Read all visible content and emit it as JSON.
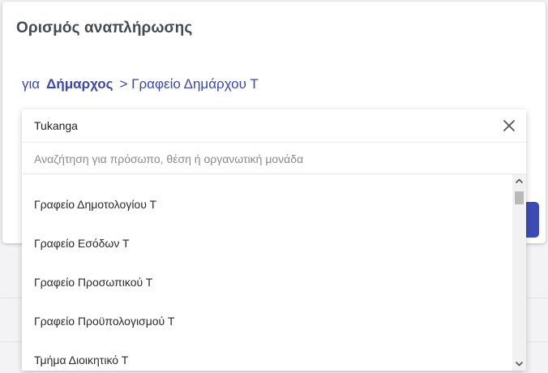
{
  "dialog": {
    "title": "Ορισμός αναπλήρωσης"
  },
  "breadcrumb": {
    "prefix": "για",
    "role": "Δήμαρχος",
    "unit": "> Γραφείο Δημάρχου Τ"
  },
  "selector": {
    "selected_value": "Tukanga",
    "search_placeholder": "Αναζήτηση για πρόσωπο, θέση ή οργανωτική μονάδα",
    "search_value": ""
  },
  "options": [
    {
      "label": "Γραφείο Δημοτολογίου Τ"
    },
    {
      "label": "Γραφείο Εσόδων Τ"
    },
    {
      "label": "Γραφείο Προσωπικού Τ"
    },
    {
      "label": "Γραφείο Προϋπολογισμού Τ"
    },
    {
      "label": "Τμήμα Διοικητικό Τ"
    }
  ],
  "icons": {
    "clear": "close-icon",
    "scroll_up": "chevron-up-icon",
    "scroll_down": "chevron-down-icon"
  },
  "colors": {
    "accent": "#3e4bb5",
    "breadcrumb": "#3c47a6",
    "title": "#444a52"
  }
}
